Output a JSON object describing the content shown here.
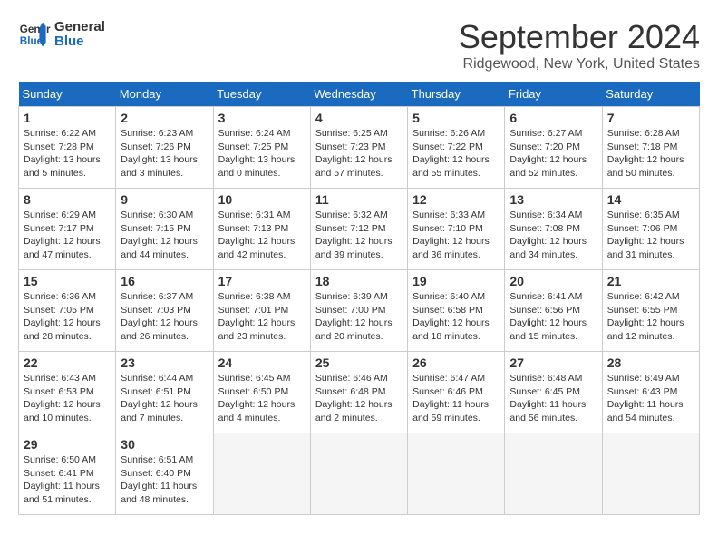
{
  "logo": {
    "line1": "General",
    "line2": "Blue"
  },
  "title": "September 2024",
  "subtitle": "Ridgewood, New York, United States",
  "days_of_week": [
    "Sunday",
    "Monday",
    "Tuesday",
    "Wednesday",
    "Thursday",
    "Friday",
    "Saturday"
  ],
  "weeks": [
    [
      {
        "day": "1",
        "info": "Sunrise: 6:22 AM\nSunset: 7:28 PM\nDaylight: 13 hours\nand 5 minutes."
      },
      {
        "day": "2",
        "info": "Sunrise: 6:23 AM\nSunset: 7:26 PM\nDaylight: 13 hours\nand 3 minutes."
      },
      {
        "day": "3",
        "info": "Sunrise: 6:24 AM\nSunset: 7:25 PM\nDaylight: 13 hours\nand 0 minutes."
      },
      {
        "day": "4",
        "info": "Sunrise: 6:25 AM\nSunset: 7:23 PM\nDaylight: 12 hours\nand 57 minutes."
      },
      {
        "day": "5",
        "info": "Sunrise: 6:26 AM\nSunset: 7:22 PM\nDaylight: 12 hours\nand 55 minutes."
      },
      {
        "day": "6",
        "info": "Sunrise: 6:27 AM\nSunset: 7:20 PM\nDaylight: 12 hours\nand 52 minutes."
      },
      {
        "day": "7",
        "info": "Sunrise: 6:28 AM\nSunset: 7:18 PM\nDaylight: 12 hours\nand 50 minutes."
      }
    ],
    [
      {
        "day": "8",
        "info": "Sunrise: 6:29 AM\nSunset: 7:17 PM\nDaylight: 12 hours\nand 47 minutes."
      },
      {
        "day": "9",
        "info": "Sunrise: 6:30 AM\nSunset: 7:15 PM\nDaylight: 12 hours\nand 44 minutes."
      },
      {
        "day": "10",
        "info": "Sunrise: 6:31 AM\nSunset: 7:13 PM\nDaylight: 12 hours\nand 42 minutes."
      },
      {
        "day": "11",
        "info": "Sunrise: 6:32 AM\nSunset: 7:12 PM\nDaylight: 12 hours\nand 39 minutes."
      },
      {
        "day": "12",
        "info": "Sunrise: 6:33 AM\nSunset: 7:10 PM\nDaylight: 12 hours\nand 36 minutes."
      },
      {
        "day": "13",
        "info": "Sunrise: 6:34 AM\nSunset: 7:08 PM\nDaylight: 12 hours\nand 34 minutes."
      },
      {
        "day": "14",
        "info": "Sunrise: 6:35 AM\nSunset: 7:06 PM\nDaylight: 12 hours\nand 31 minutes."
      }
    ],
    [
      {
        "day": "15",
        "info": "Sunrise: 6:36 AM\nSunset: 7:05 PM\nDaylight: 12 hours\nand 28 minutes."
      },
      {
        "day": "16",
        "info": "Sunrise: 6:37 AM\nSunset: 7:03 PM\nDaylight: 12 hours\nand 26 minutes."
      },
      {
        "day": "17",
        "info": "Sunrise: 6:38 AM\nSunset: 7:01 PM\nDaylight: 12 hours\nand 23 minutes."
      },
      {
        "day": "18",
        "info": "Sunrise: 6:39 AM\nSunset: 7:00 PM\nDaylight: 12 hours\nand 20 minutes."
      },
      {
        "day": "19",
        "info": "Sunrise: 6:40 AM\nSunset: 6:58 PM\nDaylight: 12 hours\nand 18 minutes."
      },
      {
        "day": "20",
        "info": "Sunrise: 6:41 AM\nSunset: 6:56 PM\nDaylight: 12 hours\nand 15 minutes."
      },
      {
        "day": "21",
        "info": "Sunrise: 6:42 AM\nSunset: 6:55 PM\nDaylight: 12 hours\nand 12 minutes."
      }
    ],
    [
      {
        "day": "22",
        "info": "Sunrise: 6:43 AM\nSunset: 6:53 PM\nDaylight: 12 hours\nand 10 minutes."
      },
      {
        "day": "23",
        "info": "Sunrise: 6:44 AM\nSunset: 6:51 PM\nDaylight: 12 hours\nand 7 minutes."
      },
      {
        "day": "24",
        "info": "Sunrise: 6:45 AM\nSunset: 6:50 PM\nDaylight: 12 hours\nand 4 minutes."
      },
      {
        "day": "25",
        "info": "Sunrise: 6:46 AM\nSunset: 6:48 PM\nDaylight: 12 hours\nand 2 minutes."
      },
      {
        "day": "26",
        "info": "Sunrise: 6:47 AM\nSunset: 6:46 PM\nDaylight: 11 hours\nand 59 minutes."
      },
      {
        "day": "27",
        "info": "Sunrise: 6:48 AM\nSunset: 6:45 PM\nDaylight: 11 hours\nand 56 minutes."
      },
      {
        "day": "28",
        "info": "Sunrise: 6:49 AM\nSunset: 6:43 PM\nDaylight: 11 hours\nand 54 minutes."
      }
    ],
    [
      {
        "day": "29",
        "info": "Sunrise: 6:50 AM\nSunset: 6:41 PM\nDaylight: 11 hours\nand 51 minutes."
      },
      {
        "day": "30",
        "info": "Sunrise: 6:51 AM\nSunset: 6:40 PM\nDaylight: 11 hours\nand 48 minutes."
      },
      {
        "day": "",
        "info": ""
      },
      {
        "day": "",
        "info": ""
      },
      {
        "day": "",
        "info": ""
      },
      {
        "day": "",
        "info": ""
      },
      {
        "day": "",
        "info": ""
      }
    ]
  ]
}
